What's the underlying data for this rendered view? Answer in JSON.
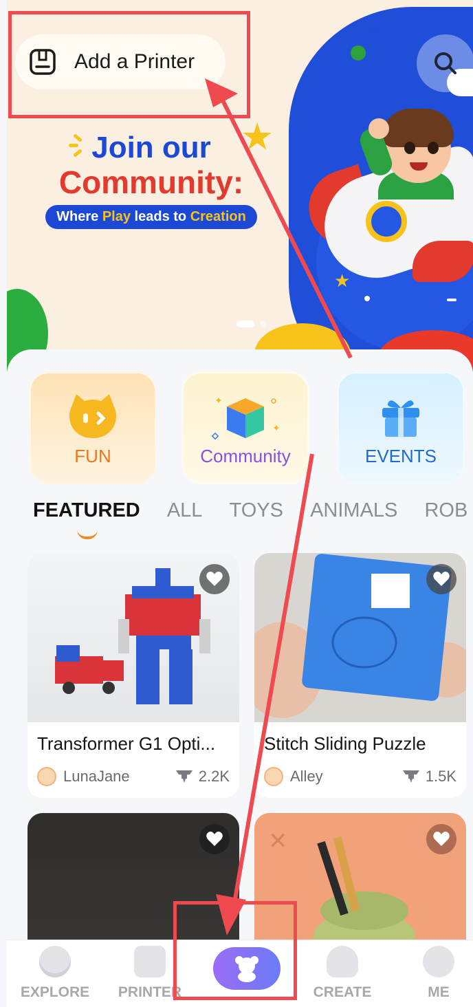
{
  "header": {
    "add_printer_label": "Add a Printer"
  },
  "banner": {
    "line1": "Join our",
    "line2": "Community:",
    "tagline_part1": "Where ",
    "tagline_hl1": "Play",
    "tagline_part2": " leads to ",
    "tagline_hl2": "Creation"
  },
  "categories": [
    {
      "label": "FUN",
      "icon": "cat-face-icon",
      "color": "#e87a1e"
    },
    {
      "label": "Community",
      "icon": "cube-icon",
      "color": "#8a4fe0"
    },
    {
      "label": "EVENTS",
      "icon": "gift-icon",
      "color": "#1f6bd0"
    }
  ],
  "tabs": [
    "FEATURED",
    "ALL",
    "TOYS",
    "ANIMALS",
    "ROB"
  ],
  "active_tab": "FEATURED",
  "cards": [
    {
      "title": "Transformer G1 Opti...",
      "author": "LunaJane",
      "count": "2.2K"
    },
    {
      "title": "Stitch Sliding Puzzle",
      "author": "Alley",
      "count": "1.5K"
    },
    {
      "title": "",
      "author": "",
      "count": ""
    },
    {
      "title": "",
      "author": "",
      "count": ""
    }
  ],
  "nav": [
    {
      "label": "EXPLORE",
      "icon": "planet-icon"
    },
    {
      "label": "PRINTER",
      "icon": "printer-icon"
    },
    {
      "label": "",
      "icon": "bear-icon"
    },
    {
      "label": "CREATE",
      "icon": "lightbulb-icon"
    },
    {
      "label": "ME",
      "icon": "face-icon"
    }
  ],
  "colors": {
    "accent": "#f08a1c",
    "annotation": "#ef4a50",
    "brand_blue": "#1c48d6",
    "brand_red": "#e23a2c"
  }
}
